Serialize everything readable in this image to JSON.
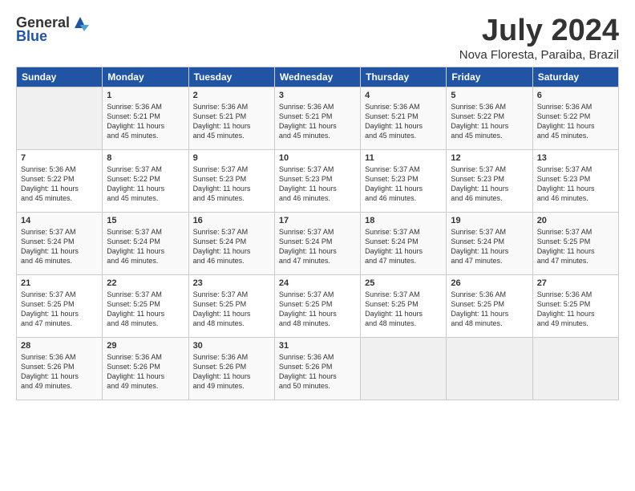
{
  "header": {
    "logo_general": "General",
    "logo_blue": "Blue",
    "month_year": "July 2024",
    "location": "Nova Floresta, Paraiba, Brazil"
  },
  "columns": [
    "Sunday",
    "Monday",
    "Tuesday",
    "Wednesday",
    "Thursday",
    "Friday",
    "Saturday"
  ],
  "weeks": [
    [
      {
        "day": "",
        "info": ""
      },
      {
        "day": "1",
        "info": "Sunrise: 5:36 AM\nSunset: 5:21 PM\nDaylight: 11 hours\nand 45 minutes."
      },
      {
        "day": "2",
        "info": "Sunrise: 5:36 AM\nSunset: 5:21 PM\nDaylight: 11 hours\nand 45 minutes."
      },
      {
        "day": "3",
        "info": "Sunrise: 5:36 AM\nSunset: 5:21 PM\nDaylight: 11 hours\nand 45 minutes."
      },
      {
        "day": "4",
        "info": "Sunrise: 5:36 AM\nSunset: 5:21 PM\nDaylight: 11 hours\nand 45 minutes."
      },
      {
        "day": "5",
        "info": "Sunrise: 5:36 AM\nSunset: 5:22 PM\nDaylight: 11 hours\nand 45 minutes."
      },
      {
        "day": "6",
        "info": "Sunrise: 5:36 AM\nSunset: 5:22 PM\nDaylight: 11 hours\nand 45 minutes."
      }
    ],
    [
      {
        "day": "7",
        "info": "Sunrise: 5:36 AM\nSunset: 5:22 PM\nDaylight: 11 hours\nand 45 minutes."
      },
      {
        "day": "8",
        "info": "Sunrise: 5:37 AM\nSunset: 5:22 PM\nDaylight: 11 hours\nand 45 minutes."
      },
      {
        "day": "9",
        "info": "Sunrise: 5:37 AM\nSunset: 5:23 PM\nDaylight: 11 hours\nand 45 minutes."
      },
      {
        "day": "10",
        "info": "Sunrise: 5:37 AM\nSunset: 5:23 PM\nDaylight: 11 hours\nand 46 minutes."
      },
      {
        "day": "11",
        "info": "Sunrise: 5:37 AM\nSunset: 5:23 PM\nDaylight: 11 hours\nand 46 minutes."
      },
      {
        "day": "12",
        "info": "Sunrise: 5:37 AM\nSunset: 5:23 PM\nDaylight: 11 hours\nand 46 minutes."
      },
      {
        "day": "13",
        "info": "Sunrise: 5:37 AM\nSunset: 5:23 PM\nDaylight: 11 hours\nand 46 minutes."
      }
    ],
    [
      {
        "day": "14",
        "info": "Sunrise: 5:37 AM\nSunset: 5:24 PM\nDaylight: 11 hours\nand 46 minutes."
      },
      {
        "day": "15",
        "info": "Sunrise: 5:37 AM\nSunset: 5:24 PM\nDaylight: 11 hours\nand 46 minutes."
      },
      {
        "day": "16",
        "info": "Sunrise: 5:37 AM\nSunset: 5:24 PM\nDaylight: 11 hours\nand 46 minutes."
      },
      {
        "day": "17",
        "info": "Sunrise: 5:37 AM\nSunset: 5:24 PM\nDaylight: 11 hours\nand 47 minutes."
      },
      {
        "day": "18",
        "info": "Sunrise: 5:37 AM\nSunset: 5:24 PM\nDaylight: 11 hours\nand 47 minutes."
      },
      {
        "day": "19",
        "info": "Sunrise: 5:37 AM\nSunset: 5:24 PM\nDaylight: 11 hours\nand 47 minutes."
      },
      {
        "day": "20",
        "info": "Sunrise: 5:37 AM\nSunset: 5:25 PM\nDaylight: 11 hours\nand 47 minutes."
      }
    ],
    [
      {
        "day": "21",
        "info": "Sunrise: 5:37 AM\nSunset: 5:25 PM\nDaylight: 11 hours\nand 47 minutes."
      },
      {
        "day": "22",
        "info": "Sunrise: 5:37 AM\nSunset: 5:25 PM\nDaylight: 11 hours\nand 48 minutes."
      },
      {
        "day": "23",
        "info": "Sunrise: 5:37 AM\nSunset: 5:25 PM\nDaylight: 11 hours\nand 48 minutes."
      },
      {
        "day": "24",
        "info": "Sunrise: 5:37 AM\nSunset: 5:25 PM\nDaylight: 11 hours\nand 48 minutes."
      },
      {
        "day": "25",
        "info": "Sunrise: 5:37 AM\nSunset: 5:25 PM\nDaylight: 11 hours\nand 48 minutes."
      },
      {
        "day": "26",
        "info": "Sunrise: 5:36 AM\nSunset: 5:25 PM\nDaylight: 11 hours\nand 48 minutes."
      },
      {
        "day": "27",
        "info": "Sunrise: 5:36 AM\nSunset: 5:25 PM\nDaylight: 11 hours\nand 49 minutes."
      }
    ],
    [
      {
        "day": "28",
        "info": "Sunrise: 5:36 AM\nSunset: 5:26 PM\nDaylight: 11 hours\nand 49 minutes."
      },
      {
        "day": "29",
        "info": "Sunrise: 5:36 AM\nSunset: 5:26 PM\nDaylight: 11 hours\nand 49 minutes."
      },
      {
        "day": "30",
        "info": "Sunrise: 5:36 AM\nSunset: 5:26 PM\nDaylight: 11 hours\nand 49 minutes."
      },
      {
        "day": "31",
        "info": "Sunrise: 5:36 AM\nSunset: 5:26 PM\nDaylight: 11 hours\nand 50 minutes."
      },
      {
        "day": "",
        "info": ""
      },
      {
        "day": "",
        "info": ""
      },
      {
        "day": "",
        "info": ""
      }
    ]
  ]
}
